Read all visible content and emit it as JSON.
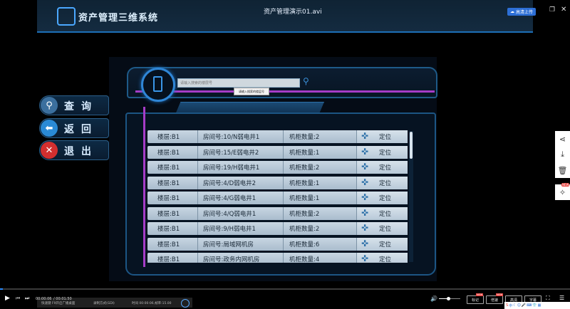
{
  "app": {
    "title": "资产管理三维系统"
  },
  "player": {
    "video_title": "资产管理演示01.avi",
    "upload_label": "高清上传",
    "time_current": "00:00:06",
    "time_total": "/ 00:01:50",
    "subtitle_1": "快速键 F9开启广播桌面",
    "subtitle_2": "录制方式(GDI)",
    "subtitle_3": "时间 00:00:06,帧率:15.00",
    "buttons": {
      "speed": "标记",
      "quality": "倍速",
      "hd": "高清",
      "subtitle": "字幕"
    },
    "tags": {
      "speed": "NEW",
      "quality": "NEW"
    },
    "ime_label": "中"
  },
  "menu": [
    {
      "label": "查询",
      "icon": "search-icon",
      "glyph": "🔍"
    },
    {
      "label": "返回",
      "icon": "back-arrow-icon",
      "glyph": "⬅"
    },
    {
      "label": "退出",
      "icon": "close-icon",
      "glyph": "✕"
    }
  ],
  "search": {
    "placeholder": "请输入搜索的楼层号",
    "tooltip": "请输入搜索的楼层号"
  },
  "rows": [
    {
      "floor": "楼层:B1",
      "room": "房间号:10/N弱电井1",
      "count": "机柜数量:2",
      "action": "定位"
    },
    {
      "floor": "楼层:B1",
      "room": "房间号:15/E弱电井2",
      "count": "机柜数量:1",
      "action": "定位"
    },
    {
      "floor": "楼层:B1",
      "room": "房间号:19/H弱电井1",
      "count": "机柜数量:2",
      "action": "定位"
    },
    {
      "floor": "楼层:B1",
      "room": "房间号:4/D弱电井2",
      "count": "机柜数量:1",
      "action": "定位"
    },
    {
      "floor": "楼层:B1",
      "room": "房间号:4/G弱电井1",
      "count": "机柜数量:1",
      "action": "定位"
    },
    {
      "floor": "楼层:B1",
      "room": "房间号:4/Q弱电井1",
      "count": "机柜数量:2",
      "action": "定位"
    },
    {
      "floor": "楼层:B1",
      "room": "房间号:9/H弱电井1",
      "count": "机柜数量:2",
      "action": "定位"
    },
    {
      "floor": "楼层:B1",
      "room": "房间号:局域网机房",
      "count": "机柜数量:6",
      "action": "定位"
    },
    {
      "floor": "楼层:B1",
      "room": "房间号:政务内网机房",
      "count": "机柜数量:4",
      "action": "定位"
    }
  ],
  "colors": {
    "accent": "#2f86d6",
    "highlight": "#a63cc7",
    "background": "#050c16"
  }
}
